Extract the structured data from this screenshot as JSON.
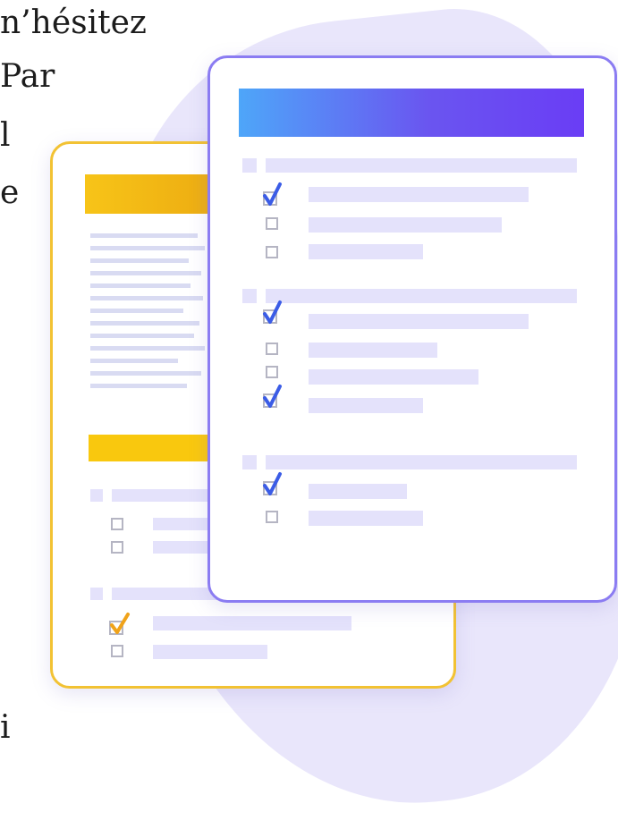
{
  "text_fragments": [
    "n’hésitez",
    "Par",
    "l",
    "e",
    "i"
  ],
  "colors": {
    "blob": "#e9e6fb",
    "card_back_border": "#f2c233",
    "card_front_border": "#8b7cf2",
    "yellow_bar": "#f7c418",
    "blue_gradient_start": "#4ea6f9",
    "blue_gradient_end": "#6a3df5",
    "placeholder_line": "#e4e2fb",
    "check_blue": "#3b5ce6",
    "check_orange": "#f0a31a"
  },
  "icons": [
    "checkmark-icon",
    "checkbox-icon"
  ],
  "back_form": {
    "checklist_states": [
      false,
      false,
      true,
      false
    ]
  },
  "front_form": {
    "groups": [
      {
        "items_checked": [
          true,
          false,
          false
        ]
      },
      {
        "items_checked": [
          true,
          false,
          false,
          true
        ]
      },
      {
        "items_checked": [
          true,
          false
        ]
      }
    ]
  }
}
